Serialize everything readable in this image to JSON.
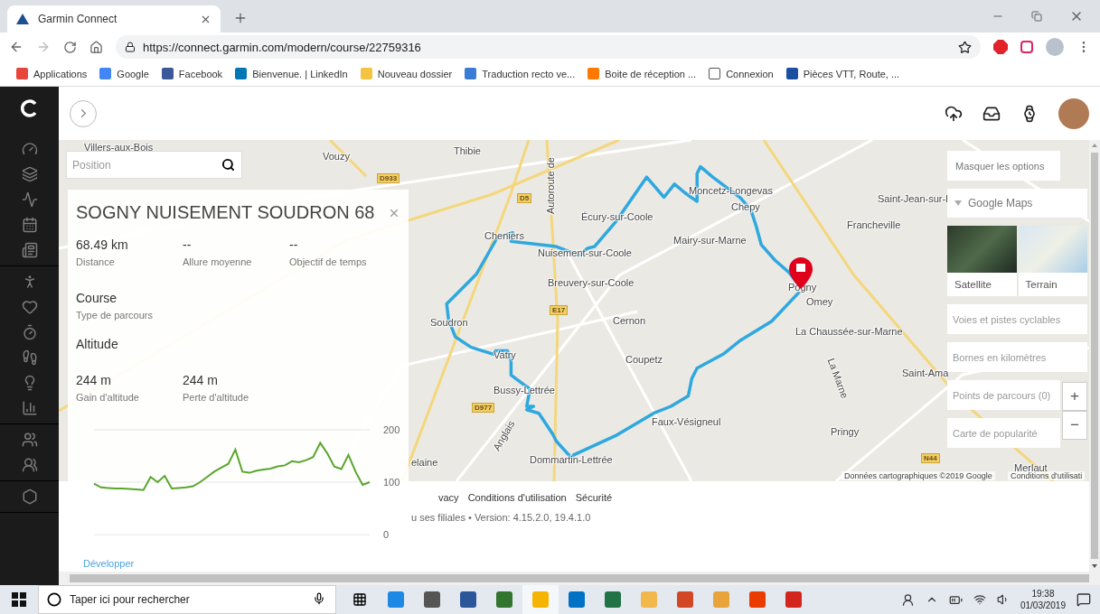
{
  "browser": {
    "tab": {
      "title": "Garmin Connect"
    },
    "url": "https://connect.garmin.com/modern/course/22759316",
    "bookmarks": [
      {
        "label": "Applications"
      },
      {
        "label": "Google"
      },
      {
        "label": "Facebook"
      },
      {
        "label": "Bienvenue. | LinkedIn"
      },
      {
        "label": "Nouveau dossier"
      },
      {
        "label": "Traduction recto ve..."
      },
      {
        "label": "Boite de réception ..."
      },
      {
        "label": "Connexion"
      },
      {
        "label": "Pièces VTT, Route, ..."
      }
    ]
  },
  "map": {
    "search": {
      "placeholder": "Position"
    },
    "labels": [
      {
        "text": "Villers-aux-Bois"
      },
      {
        "text": "Vouzy"
      },
      {
        "text": "Thibie"
      },
      {
        "text": "Écury-sur-Coole"
      },
      {
        "text": "Moncetz-Longevas"
      },
      {
        "text": "Chepy"
      },
      {
        "text": "Saint-Jean-sur-l"
      },
      {
        "text": "Francheville"
      },
      {
        "text": "Mairy-sur-Marne"
      },
      {
        "text": "Cheniers"
      },
      {
        "text": "Nuisement-sur-Coole"
      },
      {
        "text": "Breuvery-sur-Coole"
      },
      {
        "text": "Cernon"
      },
      {
        "text": "Soudron"
      },
      {
        "text": "Pogny"
      },
      {
        "text": "Omey"
      },
      {
        "text": "La Chaussée-sur-Marne"
      },
      {
        "text": "Coupetz"
      },
      {
        "text": "Saint-Ama"
      },
      {
        "text": "Vatry"
      },
      {
        "text": "Bussy-Lettrée"
      },
      {
        "text": "Faux-Vésigneul"
      },
      {
        "text": "Pringy"
      },
      {
        "text": "Dommartin-Lettrée"
      },
      {
        "text": "elaine"
      },
      {
        "text": "La Marne"
      },
      {
        "text": "Autoroute de"
      },
      {
        "text": "Anglais"
      },
      {
        "text": "Merlaut"
      }
    ],
    "road_signs": [
      {
        "text": "D933"
      },
      {
        "text": "D5"
      },
      {
        "text": "E17"
      },
      {
        "text": "D977"
      },
      {
        "text": "N44"
      }
    ],
    "attribution": "Données cartographiques ©2019 Google",
    "terms": "Conditions d'utilisati",
    "options": {
      "hide_button": "Masquer les options",
      "provider": "Google Maps",
      "map_types": [
        {
          "label": "Satellite",
          "kind": "satellite"
        },
        {
          "label": "Terrain",
          "kind": "terrain"
        }
      ],
      "layers": [
        {
          "label": "Voies et pistes cyclables",
          "on": false
        },
        {
          "label": "Bornes en kilomètres",
          "on": false
        },
        {
          "label": "Points de parcours (0)",
          "on": false
        },
        {
          "label": "Carte de popularité",
          "on": false
        }
      ]
    },
    "zoom": [
      "+",
      "−"
    ]
  },
  "course": {
    "title": "SOGNY NUISEMENT SOUDRON 68",
    "stats": [
      {
        "value": "68.49 km",
        "label": "Distance"
      },
      {
        "value": "--",
        "label": "Allure moyenne"
      },
      {
        "value": "--",
        "label": "Objectif de temps"
      }
    ],
    "type": {
      "value": "Course",
      "label": "Type de parcours"
    },
    "altitude_heading": "Altitude",
    "altitude": [
      {
        "value": "244 m",
        "label": "Gain d'altitude"
      },
      {
        "value": "244 m",
        "label": "Perte d'altitude"
      }
    ],
    "chart_data": {
      "type": "line",
      "ylim": [
        0,
        200
      ],
      "yticks": [
        0,
        100,
        200
      ],
      "values": [
        97,
        90,
        89,
        88,
        88,
        87,
        86,
        85,
        110,
        100,
        112,
        88,
        89,
        90,
        92,
        100,
        110,
        120,
        128,
        135,
        162,
        120,
        118,
        122,
        124,
        126,
        130,
        132,
        140,
        138,
        142,
        148,
        175,
        155,
        130,
        125,
        152,
        120,
        95,
        100
      ]
    },
    "expand_link": "Développer"
  },
  "footer": {
    "links": [
      "vacy",
      "Conditions d'utilisation",
      "Sécurité"
    ],
    "version": "u ses filiales • Version: 4.15.2.0, 19.4.1.0"
  },
  "taskbar": {
    "search": {
      "placeholder": "Taper ici pour rechercher"
    },
    "time": "19:38",
    "date": "01/03/2019"
  }
}
